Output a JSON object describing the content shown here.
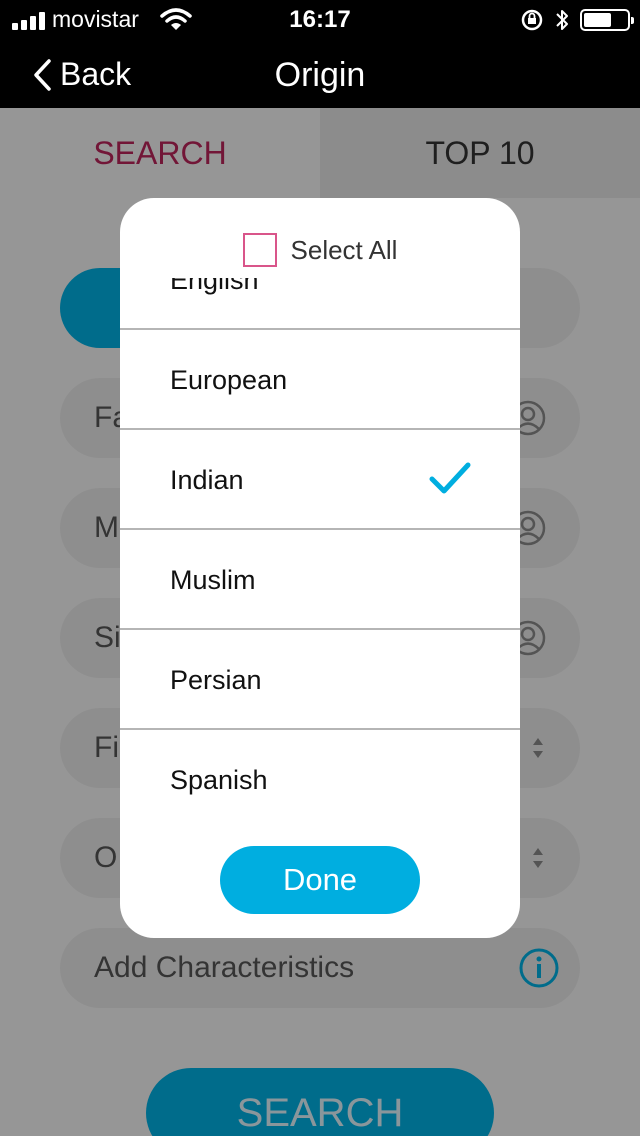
{
  "status_bar": {
    "carrier": "movistar",
    "time": "16:17",
    "signal_icon": "signal-bars-icon",
    "wifi_icon": "wifi-icon",
    "rotation_lock_icon": "rotation-lock-icon",
    "bluetooth_icon": "bluetooth-icon",
    "battery_icon": "battery-icon",
    "battery_level": 0.65
  },
  "nav": {
    "back_label": "Back",
    "title": "Origin"
  },
  "tabs": [
    {
      "label": "SEARCH",
      "active": true
    },
    {
      "label": "TOP 10",
      "active": false
    }
  ],
  "form": {
    "fields": [
      {
        "label_fragment": "Fa",
        "icon": "person-icon"
      },
      {
        "label_fragment": "M",
        "icon": "person-icon"
      },
      {
        "label_fragment": "Si",
        "icon": "person-icon"
      },
      {
        "label_fragment": "Fi",
        "icon": "stepper-icon"
      },
      {
        "label_fragment": "O",
        "icon": "stepper-icon"
      }
    ],
    "characteristics_label": "Add Characteristics",
    "info_icon": "info-icon",
    "search_button": "SEARCH"
  },
  "modal": {
    "select_all_label": "Select All",
    "select_all_checked": false,
    "items": [
      {
        "label": "English",
        "checked": false
      },
      {
        "label": "European",
        "checked": false
      },
      {
        "label": "Indian",
        "checked": true
      },
      {
        "label": "Muslim",
        "checked": false
      },
      {
        "label": "Persian",
        "checked": false
      },
      {
        "label": "Spanish",
        "checked": false
      }
    ],
    "done_label": "Done"
  },
  "colors": {
    "accent": "#00aee0",
    "active_tab": "#b8245a",
    "checkbox_border": "#d9558a",
    "nav_bg": "#000000"
  }
}
